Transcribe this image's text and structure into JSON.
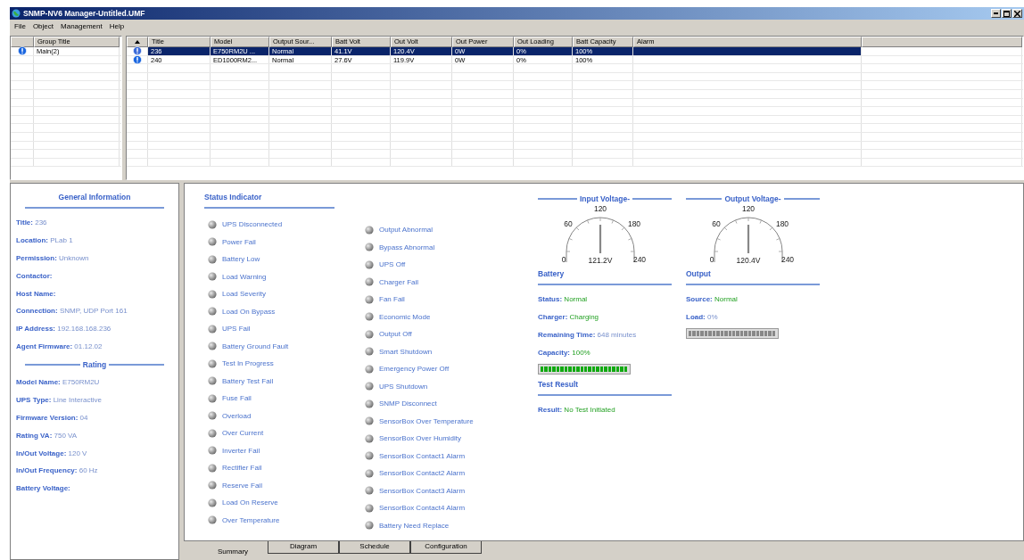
{
  "window": {
    "title": "SNMP-NV6 Manager-Untitled.UMF"
  },
  "menu": [
    "File",
    "Object",
    "Management",
    "Help"
  ],
  "groups": {
    "columns": [
      "Group Title"
    ],
    "rows": [
      {
        "title": "Main(2)",
        "selected": false
      }
    ]
  },
  "devices": {
    "columns": [
      "Title",
      "Model",
      "Output Sour...",
      "Batt Volt",
      "Out Volt",
      "Out Power",
      "Out Loading",
      "Batt Capacity",
      "Alarm"
    ],
    "rows": [
      {
        "selected": true,
        "cells": [
          "236",
          "E750RM2U ...",
          "Normal",
          "41.1V",
          "120.4V",
          "0W",
          "0%",
          "100%"
        ]
      },
      {
        "selected": false,
        "cells": [
          "240",
          "ED1000RM2...",
          "Normal",
          "27.6V",
          "119.9V",
          "0W",
          "0%",
          "100%"
        ]
      }
    ]
  },
  "general_information": {
    "heading": "General Information",
    "fields": [
      {
        "label": "Title:",
        "value": "236"
      },
      {
        "label": "Location:",
        "value": "PLab 1"
      },
      {
        "label": "Permission:",
        "value": "Unknown"
      },
      {
        "label": "Contactor:"
      },
      {
        "label": "Host Name:"
      },
      {
        "label": "Connection:",
        "value": "SNMP, UDP Port 161"
      },
      {
        "label": "IP Address:",
        "value": "192.168.168.236"
      },
      {
        "label": "Agent Firmware:",
        "value": "01.12.02"
      }
    ],
    "rating_heading": "Rating",
    "rating_fields": [
      {
        "label": "Model Name:",
        "value": "E750RM2U"
      },
      {
        "label": "UPS Type:",
        "value": "Line Interactive"
      },
      {
        "label": "Firmware Version:",
        "value": "04"
      },
      {
        "label": "Rating VA:",
        "value": "750 VA"
      },
      {
        "label": "In/Out Voltage:",
        "value": "120 V"
      },
      {
        "label": "In/Out Frequency:",
        "value": "60 Hz"
      },
      {
        "label": "Battery Voltage:"
      }
    ]
  },
  "status_indicator": {
    "heading": "Status Indicator",
    "columns": [
      [
        "UPS Disconnected",
        "Power Fail",
        "Battery Low",
        "Load Warning",
        "Load Severity",
        "Load On Bypass",
        "UPS Fail",
        "Battery Ground Fault",
        "Test In Progress",
        "Battery Test Fail",
        "Fuse Fail",
        "Overload",
        "Over Current",
        "Inverter Fail",
        "Rectifier Fail",
        "Reserve Fail",
        "Load On Reserve",
        "Over Temperature"
      ],
      [
        "Output Abnormal",
        "Bypass Abnormal",
        "UPS Off",
        "Charger Fail",
        "Fan Fail",
        "Economic Mode",
        "Output Off",
        "Smart Shutdown",
        "Emergency Power Off",
        "UPS Shutdown",
        "SNMP Disconnect",
        "SensorBox Over Temperature",
        "SensorBox Over Humidity",
        "SensorBox Contact1 Alarm",
        "SensorBox Contact2 Alarm",
        "SensorBox Contact3 Alarm",
        "SensorBox Contact4 Alarm",
        "Battery Need Replace"
      ]
    ]
  },
  "gauges": [
    {
      "title": "Input Voltage-",
      "ticks": [
        "0",
        "60",
        "120",
        "180",
        "240"
      ],
      "reading": "121.2V"
    },
    {
      "title": "Output Voltage-",
      "ticks": [
        "0",
        "60",
        "120",
        "180",
        "240"
      ],
      "reading": "120.4V"
    }
  ],
  "battery": {
    "heading": "Battery",
    "fields": [
      {
        "label": "Status:",
        "value": "Normal",
        "highlight": true
      },
      {
        "label": "Charger:",
        "value": "Charging",
        "highlight": true
      },
      {
        "label": "Remaining Time:",
        "value": "648 minutes",
        "highlight": false
      },
      {
        "label": "Capacity:",
        "value": "100%",
        "highlight": true
      }
    ],
    "capacity_bar": {
      "level": 1
    }
  },
  "test_result": {
    "heading": "Test Result",
    "fields": [
      {
        "label": "Result:",
        "value": "No Test Initiated",
        "highlight": true
      }
    ]
  },
  "output": {
    "heading": "Output",
    "fields": [
      {
        "label": "Source:",
        "value": "Normal",
        "highlight": true
      },
      {
        "label": "Load:",
        "value": "0%",
        "highlight": false
      }
    ],
    "load_bar": {
      "level": 0
    }
  },
  "tabs": [
    {
      "label": "Summary",
      "selected": true
    },
    {
      "label": "Diagram",
      "selected": false
    },
    {
      "label": "Schedule",
      "selected": false
    },
    {
      "label": "Configuration",
      "selected": false
    }
  ]
}
